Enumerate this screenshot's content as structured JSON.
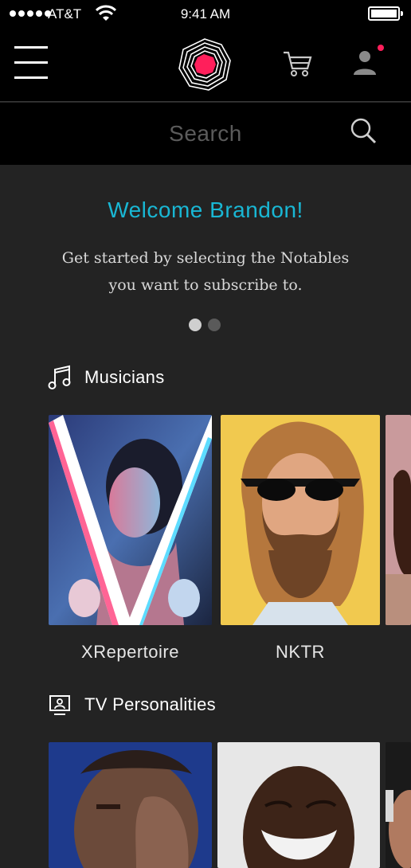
{
  "status": {
    "carrier": "AT&T",
    "time": "9:41 AM"
  },
  "header": {
    "menu_icon": "hamburger-menu-icon",
    "logo": "notables-logo",
    "cart_icon": "cart-icon",
    "profile_icon": "profile-icon",
    "accent_color": "#ff1f5b"
  },
  "search": {
    "placeholder": "Search",
    "value": ""
  },
  "welcome": {
    "title": "Welcome Brandon!",
    "title_color": "#19b7d4",
    "subtitle_line1": "Get started by selecting the Notables",
    "subtitle_line2": "you want to subscribe to."
  },
  "carousel": {
    "pages": 2,
    "active_index": 0
  },
  "sections": {
    "musicians": {
      "label": "Musicians",
      "icon": "music-note-icon",
      "items": [
        {
          "name": "XRepertoire"
        },
        {
          "name": "NKTR"
        }
      ]
    },
    "tv": {
      "label": "TV Personalities",
      "icon": "tv-person-icon"
    }
  }
}
